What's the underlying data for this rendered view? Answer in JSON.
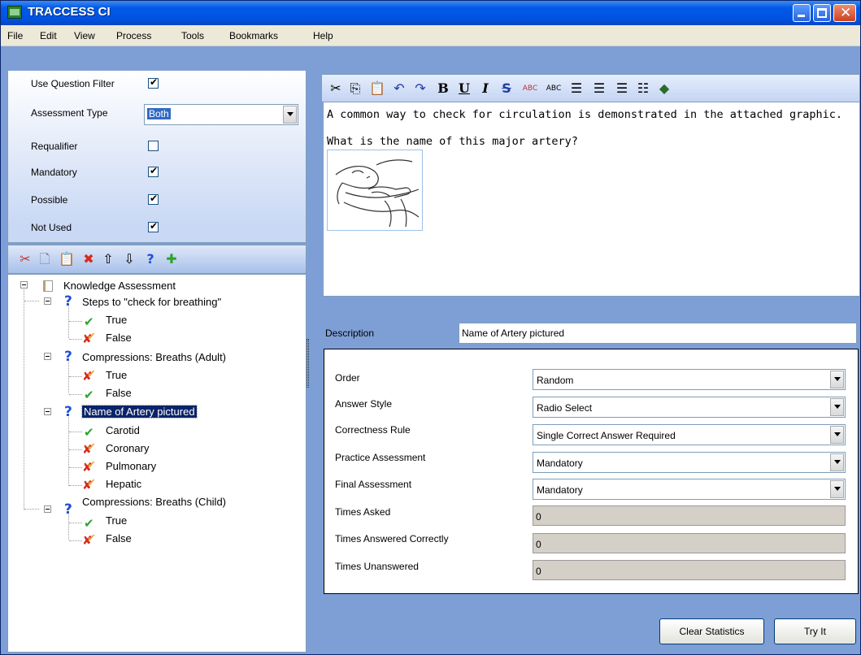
{
  "window": {
    "title": "TRACCESS CI"
  },
  "menu": [
    "File",
    "Edit",
    "View",
    "Process",
    "Tools",
    "Bookmarks",
    "Help"
  ],
  "filter": {
    "use_question_filter": {
      "label": "Use Question Filter",
      "checked": true
    },
    "assessment_type": {
      "label": "Assessment Type",
      "value": "Both"
    },
    "requalifier": {
      "label": "Requalifier",
      "checked": false
    },
    "mandatory": {
      "label": "Mandatory",
      "checked": true
    },
    "possible": {
      "label": "Possible",
      "checked": true
    },
    "not_used": {
      "label": "Not Used",
      "checked": true
    }
  },
  "tree_toolbar": [
    "cut-icon",
    "new-document-icon",
    "paste-icon",
    "delete-icon",
    "move-up-icon",
    "move-down-icon",
    "add-question-icon",
    "add-answer-icon"
  ],
  "tree": {
    "root": "Knowledge Assessment",
    "questions": [
      {
        "label": "Steps to \"check for breathing\"",
        "answers": [
          {
            "label": "True",
            "correct": true
          },
          {
            "label": "False",
            "correct": false
          }
        ]
      },
      {
        "label": "Compressions: Breaths (Adult)",
        "answers": [
          {
            "label": "True",
            "correct": false
          },
          {
            "label": "False",
            "correct": true
          }
        ]
      },
      {
        "label": "Name of Artery pictured",
        "selected": true,
        "answers": [
          {
            "label": "Carotid",
            "correct": true
          },
          {
            "label": "Coronary",
            "correct": false
          },
          {
            "label": "Pulmonary",
            "correct": false
          },
          {
            "label": "Hepatic",
            "correct": false
          }
        ]
      },
      {
        "label": "Compressions: Breaths (Child)",
        "answers": [
          {
            "label": "True",
            "correct": true
          },
          {
            "label": "False",
            "correct": false
          }
        ]
      }
    ]
  },
  "editor_toolbar": [
    "cut-icon",
    "copy-icon",
    "paste-icon",
    "undo-icon",
    "redo-icon",
    "bold-icon",
    "underline-icon",
    "italic-icon",
    "strikethrough-icon",
    "spellcheck-icon",
    "spellcheck-all-icon",
    "align-left-icon",
    "align-center-icon",
    "align-right-icon",
    "bullet-list-icon",
    "fill-color-icon"
  ],
  "editor": {
    "paragraph1": "A common way to check for circulation is demonstrated in the attached graphic.",
    "paragraph2": "What is the name of this major artery?"
  },
  "description": {
    "label": "Description",
    "value": "Name of Artery pictured"
  },
  "properties": {
    "order": {
      "label": "Order",
      "value": "Random"
    },
    "answer_style": {
      "label": "Answer Style",
      "value": "Radio Select"
    },
    "correctness_rule": {
      "label": "Correctness Rule",
      "value": "Single Correct Answer Required"
    },
    "practice_assessment": {
      "label": "Practice Assessment",
      "value": "Mandatory"
    },
    "final_assessment": {
      "label": "Final Assessment",
      "value": "Mandatory"
    },
    "times_asked": {
      "label": "Times Asked",
      "value": "0"
    },
    "times_answered_correctly": {
      "label": "Times Answered Correctly",
      "value": "0"
    },
    "times_unanswered": {
      "label": "Times Unanswered",
      "value": "0"
    }
  },
  "buttons": {
    "clear_statistics": "Clear Statistics",
    "try_it": "Try It"
  }
}
